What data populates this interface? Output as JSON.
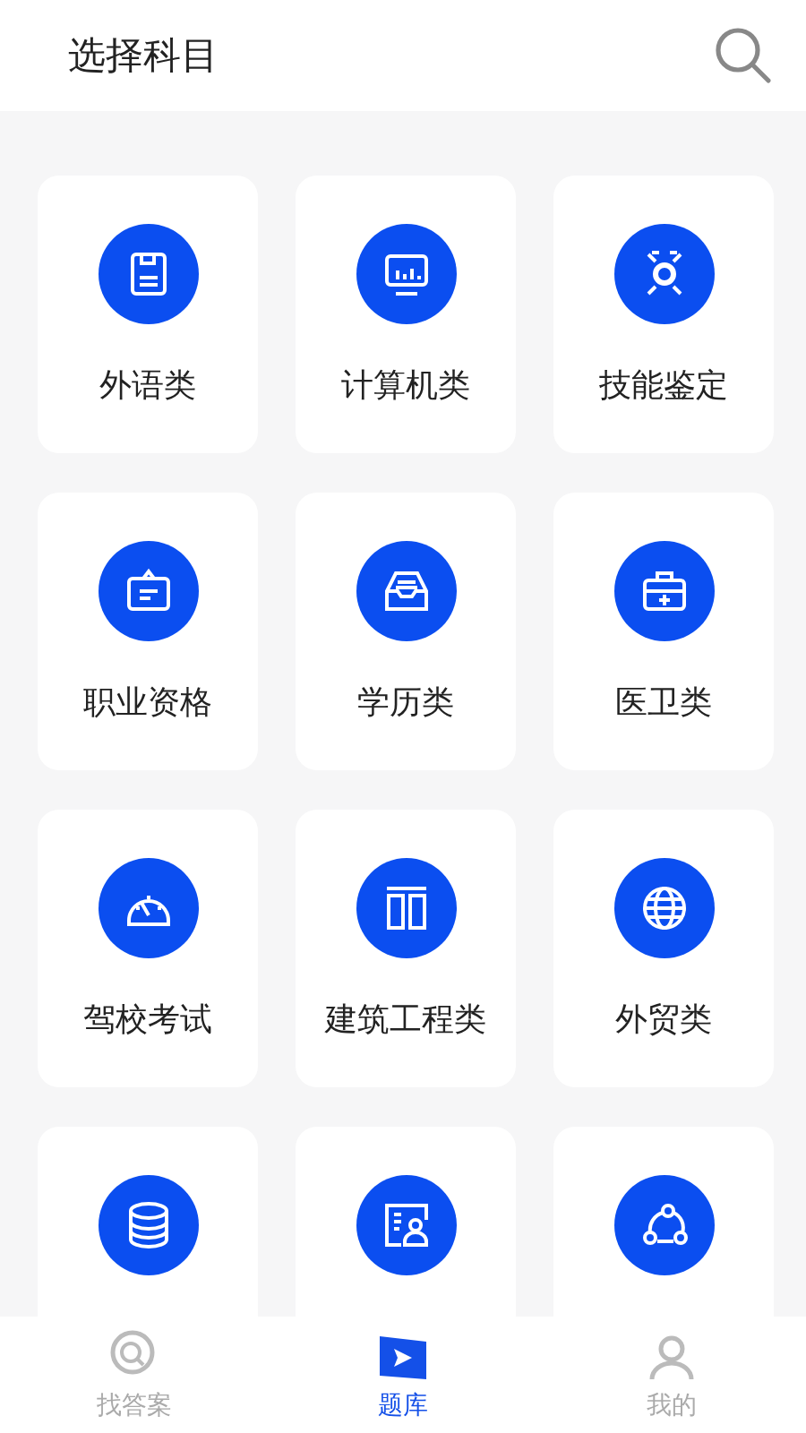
{
  "header": {
    "title": "选择科目"
  },
  "categories": [
    {
      "kind": "full",
      "label": "外语类"
    },
    {
      "kind": "full",
      "label": "计算机类"
    },
    {
      "kind": "full",
      "label": "技能鉴定"
    },
    {
      "kind": "full",
      "label": "职业资格"
    },
    {
      "kind": "full",
      "label": "学历类"
    },
    {
      "kind": "full",
      "label": "医卫类"
    },
    {
      "kind": "full",
      "label": "驾校考试"
    },
    {
      "kind": "full",
      "label": "建筑工程类"
    },
    {
      "kind": "full",
      "label": "外贸类"
    },
    {
      "kind": "cut_off"
    },
    {
      "kind": "cut_off"
    },
    {
      "kind": "cut_off"
    }
  ],
  "tab_bar": [
    {
      "label": "找答案",
      "selected": false
    },
    {
      "label": "题库",
      "selected": true
    },
    {
      "label": "我的",
      "selected": false
    }
  ]
}
